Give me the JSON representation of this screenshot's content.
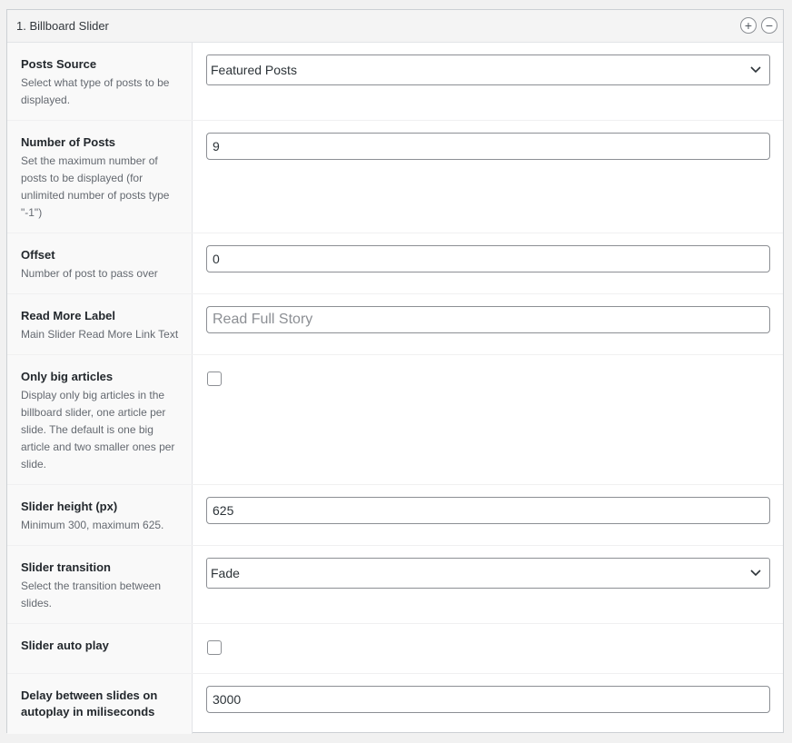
{
  "panel": {
    "title": "1. Billboard Slider",
    "expand_icon": "plus-circle-icon",
    "collapse_icon": "minus-circle-icon",
    "plus_glyph": "+",
    "minus_glyph": "−"
  },
  "fields": {
    "posts_source": {
      "label": "Posts Source",
      "description": "Select what type of posts to be displayed.",
      "value": "Featured Posts"
    },
    "number_of_posts": {
      "label": "Number of Posts",
      "description": "Set the maximum number of posts to be displayed (for unlimited number of posts type \"-1\")",
      "value": "9"
    },
    "offset": {
      "label": "Offset",
      "description": "Number of post to pass over",
      "value": "0"
    },
    "read_more_label": {
      "label": "Read More Label",
      "description": "Main Slider Read More Link Text",
      "value": "",
      "placeholder": "Read Full Story"
    },
    "only_big_articles": {
      "label": "Only big articles",
      "description": "Display only big articles in the billboard slider, one article per slide. The default is one big article and two smaller ones per slide.",
      "checked": false
    },
    "slider_height": {
      "label": "Slider height (px)",
      "description": "Minimum 300, maximum 625.",
      "value": "625"
    },
    "slider_transition": {
      "label": "Slider transition",
      "description": "Select the transition between slides.",
      "value": "Fade"
    },
    "slider_auto_play": {
      "label": "Slider auto play",
      "checked": false
    },
    "autoplay_delay": {
      "label": "Delay between slides on autoplay in miliseconds",
      "value": "3000"
    }
  }
}
